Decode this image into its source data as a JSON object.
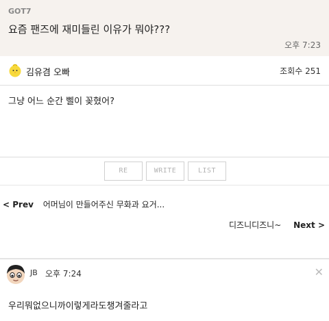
{
  "question": {
    "group": "GOT7",
    "text": "요즘 팬즈에 재미들린 이유가 뭐야???",
    "time": "오후 7:23"
  },
  "answer": {
    "author_icon": "chick-icon",
    "author": "김유겸 오빠",
    "views": "조회수 251",
    "text": "그냥 어느 순간 삘이 꽂혔어?"
  },
  "buttons": {
    "re": "RE",
    "write": "WRITE",
    "list": "LIST"
  },
  "navigation": {
    "prev_label": "< Prev",
    "prev_title": "어머님이 만들어주신 무화과 요거...",
    "next_title": "디즈니디즈니~",
    "next_label": "Next >"
  },
  "comment": {
    "avatar_icon": "avatar-icon",
    "name": "JB",
    "time": "오후 7:24",
    "close_icon": "close-icon",
    "text": "우리뭐없으니까이렇게라도챙겨줄라고"
  }
}
